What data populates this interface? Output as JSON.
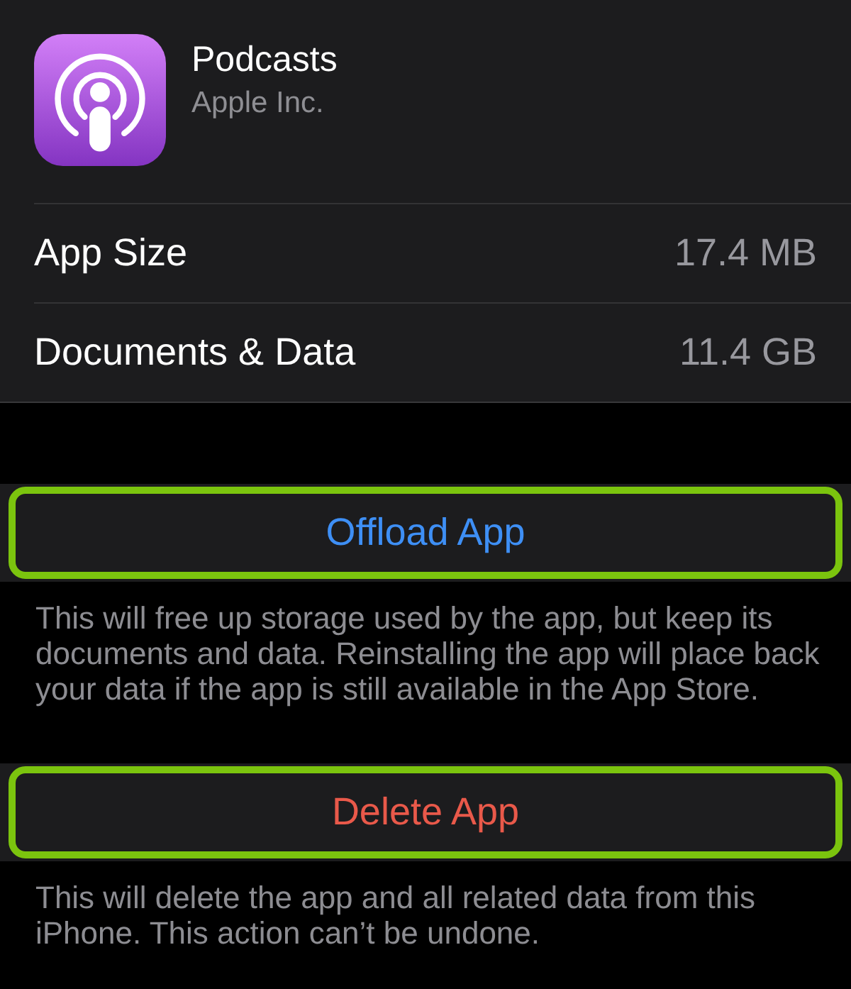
{
  "app": {
    "name": "Podcasts",
    "developer": "Apple Inc."
  },
  "details": [
    {
      "label": "App Size",
      "value": "17.4 MB"
    },
    {
      "label": "Documents & Data",
      "value": "11.4 GB"
    }
  ],
  "actions": [
    {
      "label": "Offload App",
      "kind": "offload",
      "highlighted": true,
      "note": "This will free up storage used by the app, but keep its documents and data. Reinstalling the app will place back your data if the app is still available in the App Store."
    },
    {
      "label": "Delete App",
      "kind": "delete",
      "highlighted": true,
      "note": "This will delete the app and all related data from this iPhone. This action can’t be undone."
    }
  ]
}
